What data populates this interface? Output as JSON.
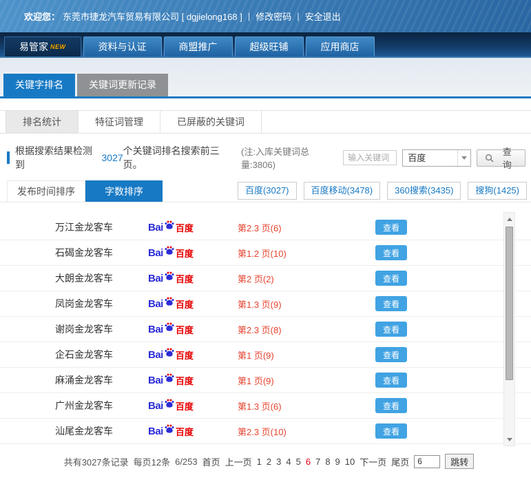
{
  "welcome_bar": {
    "prefix": "欢迎您：",
    "company": "东莞市捷龙汽车贸易有限公司 [ dgjielong168 ]",
    "sep1": "|",
    "change_password": "修改密码",
    "sep2": "|",
    "logout": "安全退出"
  },
  "nav": {
    "items": [
      {
        "label": "易管家",
        "badge": "NEW"
      },
      {
        "label": "资料与认证"
      },
      {
        "label": "商盟推广"
      },
      {
        "label": "超级旺铺"
      },
      {
        "label": "应用商店"
      }
    ]
  },
  "tabs": [
    {
      "label": "关键字排名"
    },
    {
      "label": "关键词更新记录"
    }
  ],
  "subtabs": [
    {
      "label": "排名统计"
    },
    {
      "label": "特征词管理"
    },
    {
      "label": "已屏蔽的关键词"
    }
  ],
  "summary": {
    "text_before": "根据搜索结果检测到",
    "count": "3027",
    "text_after": "个关键词排名搜索前三页。",
    "note": "(注:入库关键词总量:3806)"
  },
  "search": {
    "placeholder": "输入关键词",
    "engine_selected": "百度",
    "query_label": "查 询"
  },
  "sort_tabs": [
    {
      "label": "发布时间排序"
    },
    {
      "label": "字数排序"
    }
  ],
  "engine_filters": [
    {
      "label": "百度(3027)"
    },
    {
      "label": "百度移动(3478)"
    },
    {
      "label": "360搜索(3435)"
    },
    {
      "label": "搜狗(1425)"
    }
  ],
  "table": {
    "view_label": "查看",
    "baidu_logo": {
      "bai": "Bai",
      "du": "百度"
    },
    "rows": [
      {
        "keyword": "万江金龙客车",
        "rank": "第2.3 页(6)"
      },
      {
        "keyword": "石碣金龙客车",
        "rank": "第1.2 页(10)"
      },
      {
        "keyword": "大朗金龙客车",
        "rank": "第2 页(2)"
      },
      {
        "keyword": "凤岗金龙客车",
        "rank": "第1.3 页(9)"
      },
      {
        "keyword": "谢岗金龙客车",
        "rank": "第2.3 页(8)"
      },
      {
        "keyword": "企石金龙客车",
        "rank": "第1 页(9)"
      },
      {
        "keyword": "麻涌金龙客车",
        "rank": "第1 页(9)"
      },
      {
        "keyword": "广州金龙客车",
        "rank": "第1.3 页(6)"
      },
      {
        "keyword": "汕尾金龙客车",
        "rank": "第2.3 页(10)"
      }
    ]
  },
  "pagination": {
    "total_text": "共有3027条记录",
    "per_page_text": "每页12条",
    "page_indicator": "6/253",
    "first": "首页",
    "prev": "上一页",
    "pages": [
      "1",
      "2",
      "3",
      "4",
      "5",
      "6",
      "7",
      "8",
      "9",
      "10"
    ],
    "current_page": "6",
    "next": "下一页",
    "last": "尾页",
    "jump_value": "6",
    "jump_label": "跳转"
  },
  "colors": {
    "accent_blue": "#1779c4",
    "nav_dark_blue": "#0a2a4c",
    "rank_red": "#e6432f",
    "view_button_blue": "#41a3e3",
    "current_page_red": "#e60012",
    "baidu_blue": "#2c2cd6",
    "baidu_red": "#e60000"
  }
}
